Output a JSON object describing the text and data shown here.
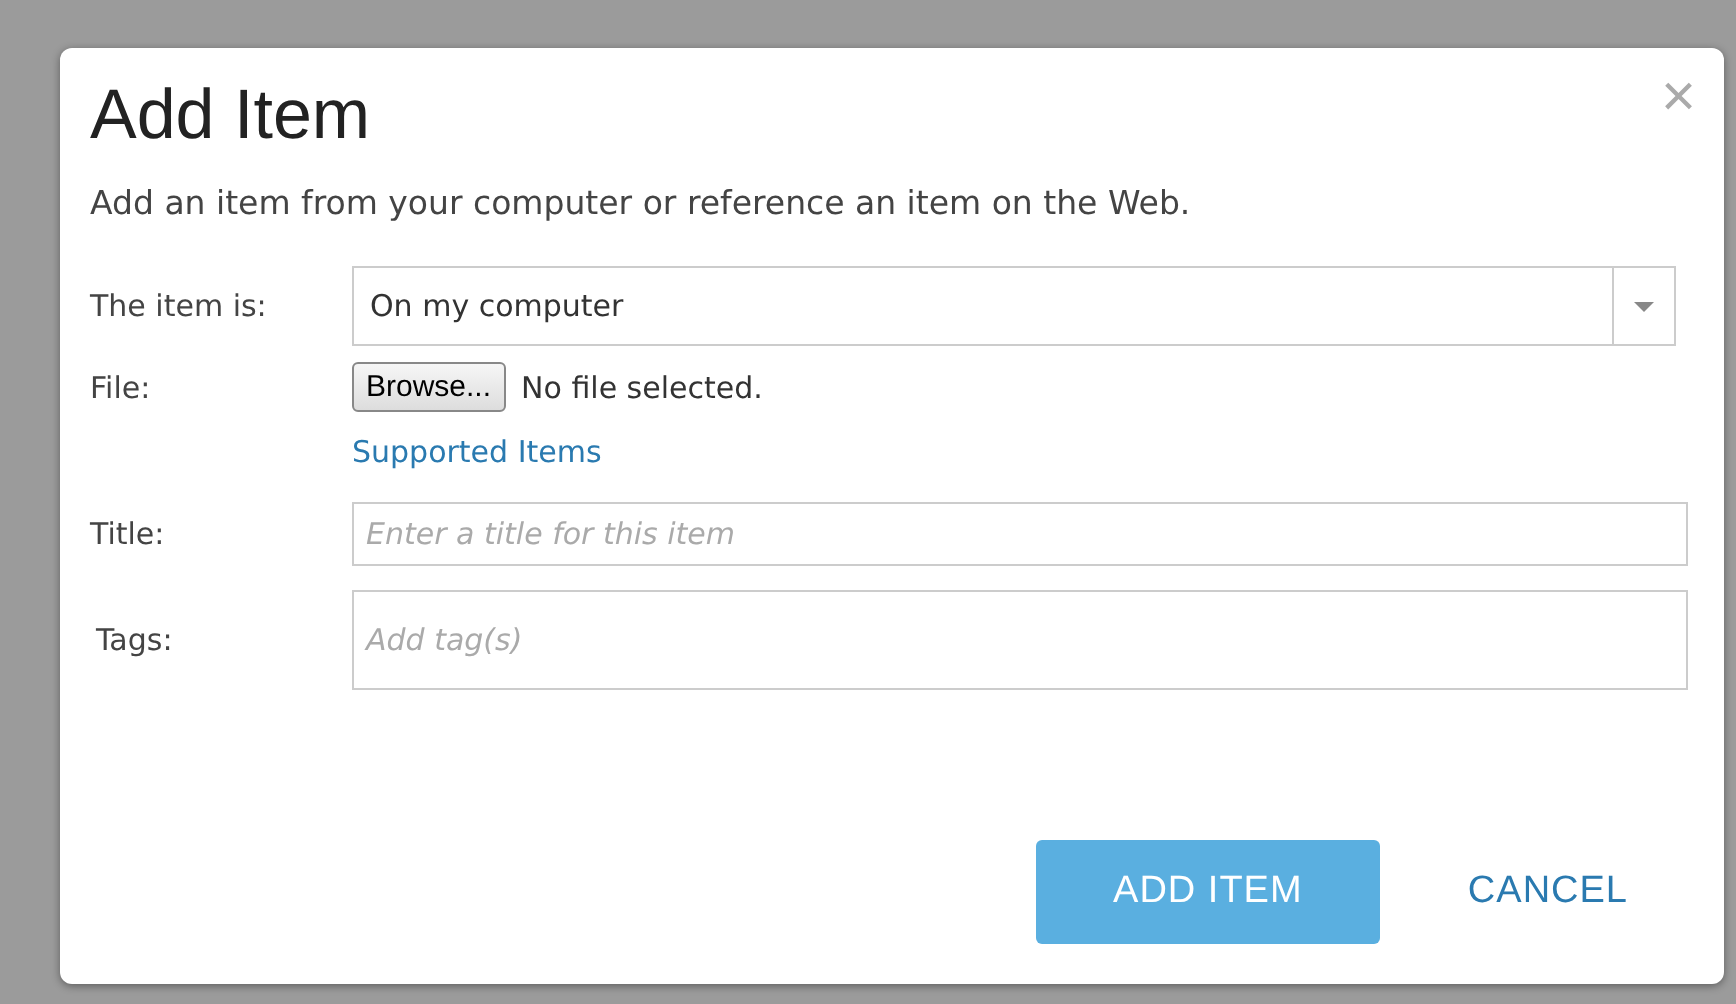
{
  "dialog": {
    "title": "Add Item",
    "close": "×",
    "intro": "Add an item from your computer or reference an item on the Web.",
    "source": {
      "label": "The item is:",
      "value": "On my computer"
    },
    "file": {
      "label": "File:",
      "button": "Browse...",
      "status": "No file selected.",
      "link": "Supported Items"
    },
    "title_field": {
      "label": "Title:",
      "placeholder": "Enter a title for this item"
    },
    "tags_field": {
      "label": "Tags:",
      "placeholder": "Add tag(s)"
    },
    "buttons": [
      {
        "kind": "primary",
        "label": "ADD ITEM"
      },
      {
        "kind": "link",
        "label": "CANCEL"
      }
    ]
  }
}
